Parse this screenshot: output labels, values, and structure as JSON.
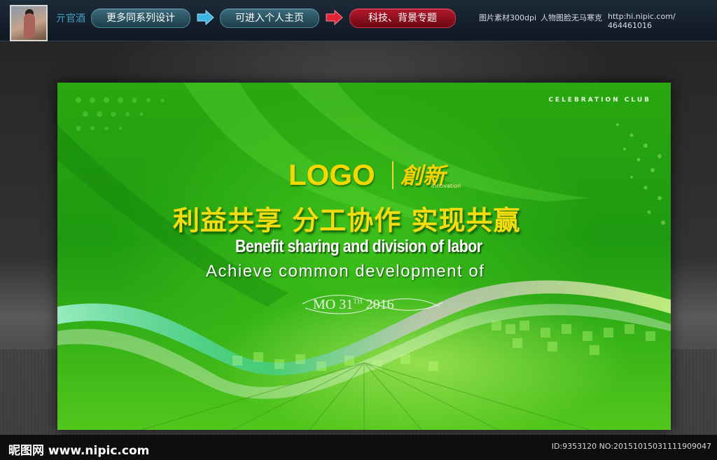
{
  "header": {
    "username": "亓官酒",
    "nav_buttons": [
      {
        "label": "更多同系列设计"
      },
      {
        "label": "可进入个人主页"
      },
      {
        "label": "科技、背景专题"
      }
    ],
    "info_text_1": "图片素材300dpi",
    "info_text_2": "人物图脸无马寒克",
    "profile_url": "http:hi.nipic.com/ 464461016"
  },
  "banner": {
    "celebration": "CELEBRATION CLUB",
    "logo": "LOGO",
    "innovation_cn": "創新",
    "innovation_en": "innovation",
    "slogan_cn": "利益共享 分工协作 实现共赢",
    "slogan_en_1": "Benefit sharing and division of labor",
    "slogan_en_2": "Achieve common development of",
    "date_main": "MO 31",
    "date_sup": "TH",
    "date_year": " 2016"
  },
  "footer": {
    "site": "昵图网 www.nipic.com",
    "image_id": "ID:9353120 NO:20151015031111909047"
  },
  "colors": {
    "accent_gold": "#f5dc10",
    "banner_green": "#2aa80f",
    "red_button": "#b3172a",
    "teal_button": "#3a6a7a"
  }
}
